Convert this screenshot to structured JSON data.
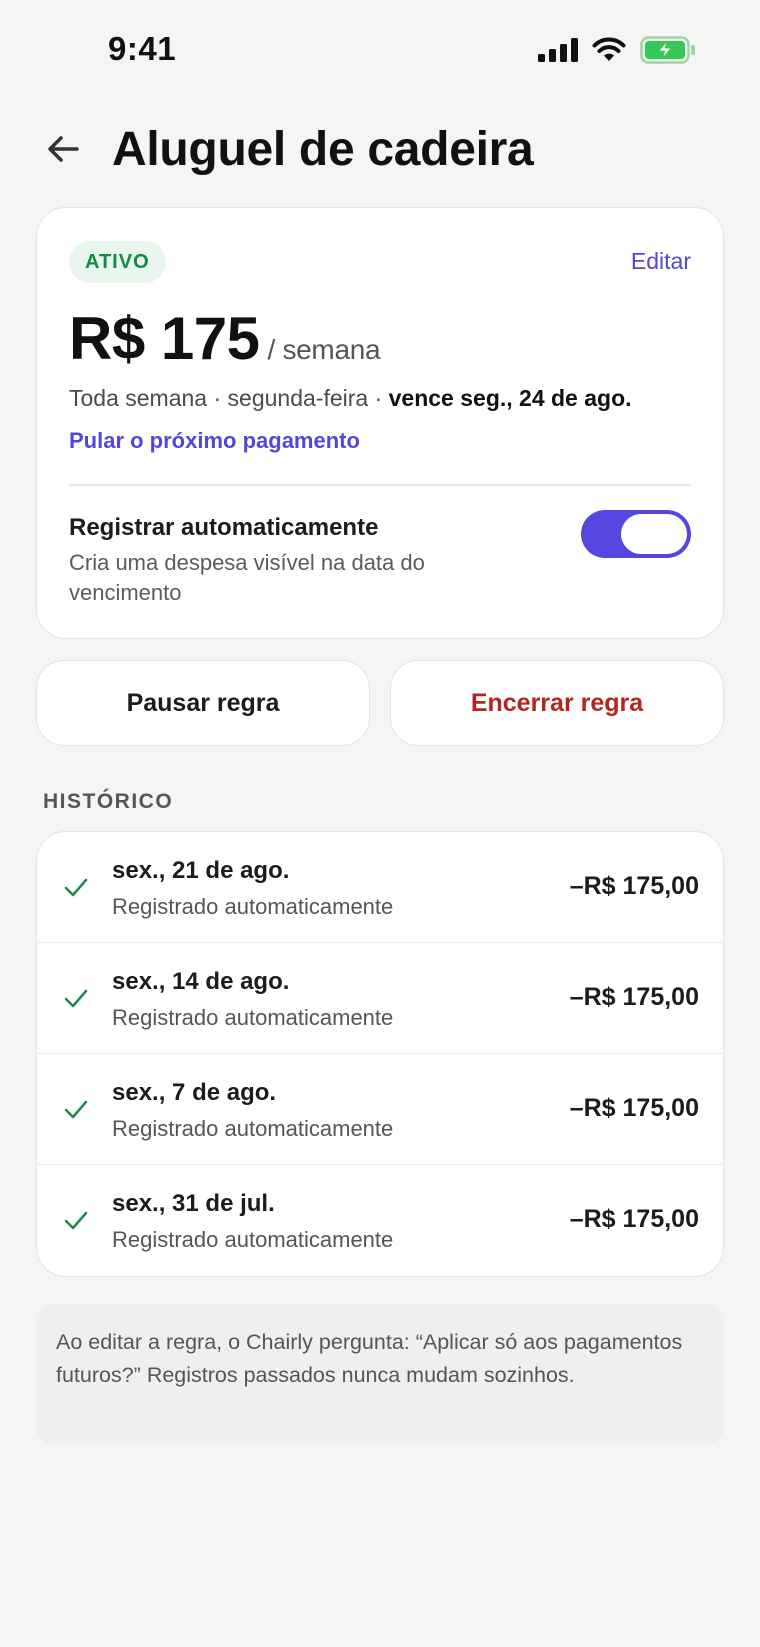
{
  "status_bar": {
    "time": "9:41",
    "icons": [
      "cellular-signal-icon",
      "wifi-icon",
      "battery-charging-icon"
    ]
  },
  "header": {
    "back_icon": "arrow-left-icon",
    "title": "Aluguel de cadeira"
  },
  "rule": {
    "status_badge": "ATIVO",
    "edit_label": "Editar",
    "amount": "R$ 175",
    "period": "/ semana",
    "schedule_prefix": "Toda semana · segunda-feira · ",
    "schedule_due": "vence seg., 24 de ago.",
    "skip_label": "Pular o próximo pagamento",
    "auto_register": {
      "title": "Registrar automaticamente",
      "description": "Cria uma despesa visível na data do vencimento",
      "enabled": true
    }
  },
  "actions": {
    "pause_label": "Pausar regra",
    "end_label": "Encerrar regra"
  },
  "history": {
    "section_label": "HISTÓRICO",
    "items": [
      {
        "date": "sex., 21 de ago.",
        "subtitle": "Registrado automaticamente",
        "amount": "–R$ 175,00"
      },
      {
        "date": "sex., 14 de ago.",
        "subtitle": "Registrado automaticamente",
        "amount": "–R$ 175,00"
      },
      {
        "date": "sex., 7 de ago.",
        "subtitle": "Registrado automaticamente",
        "amount": "–R$ 175,00"
      },
      {
        "date": "sex., 31 de jul.",
        "subtitle": "Registrado automaticamente",
        "amount": "–R$ 175,00"
      }
    ]
  },
  "note": "Ao editar a regra, o Chairly pergunta: “Aplicar só aos pagamentos futuros?” Registros passados nunca mudam sozinhos.",
  "colors": {
    "accent": "#5546e0",
    "success": "#138a43",
    "danger": "#b3261e",
    "background": "#f5f5f4"
  }
}
